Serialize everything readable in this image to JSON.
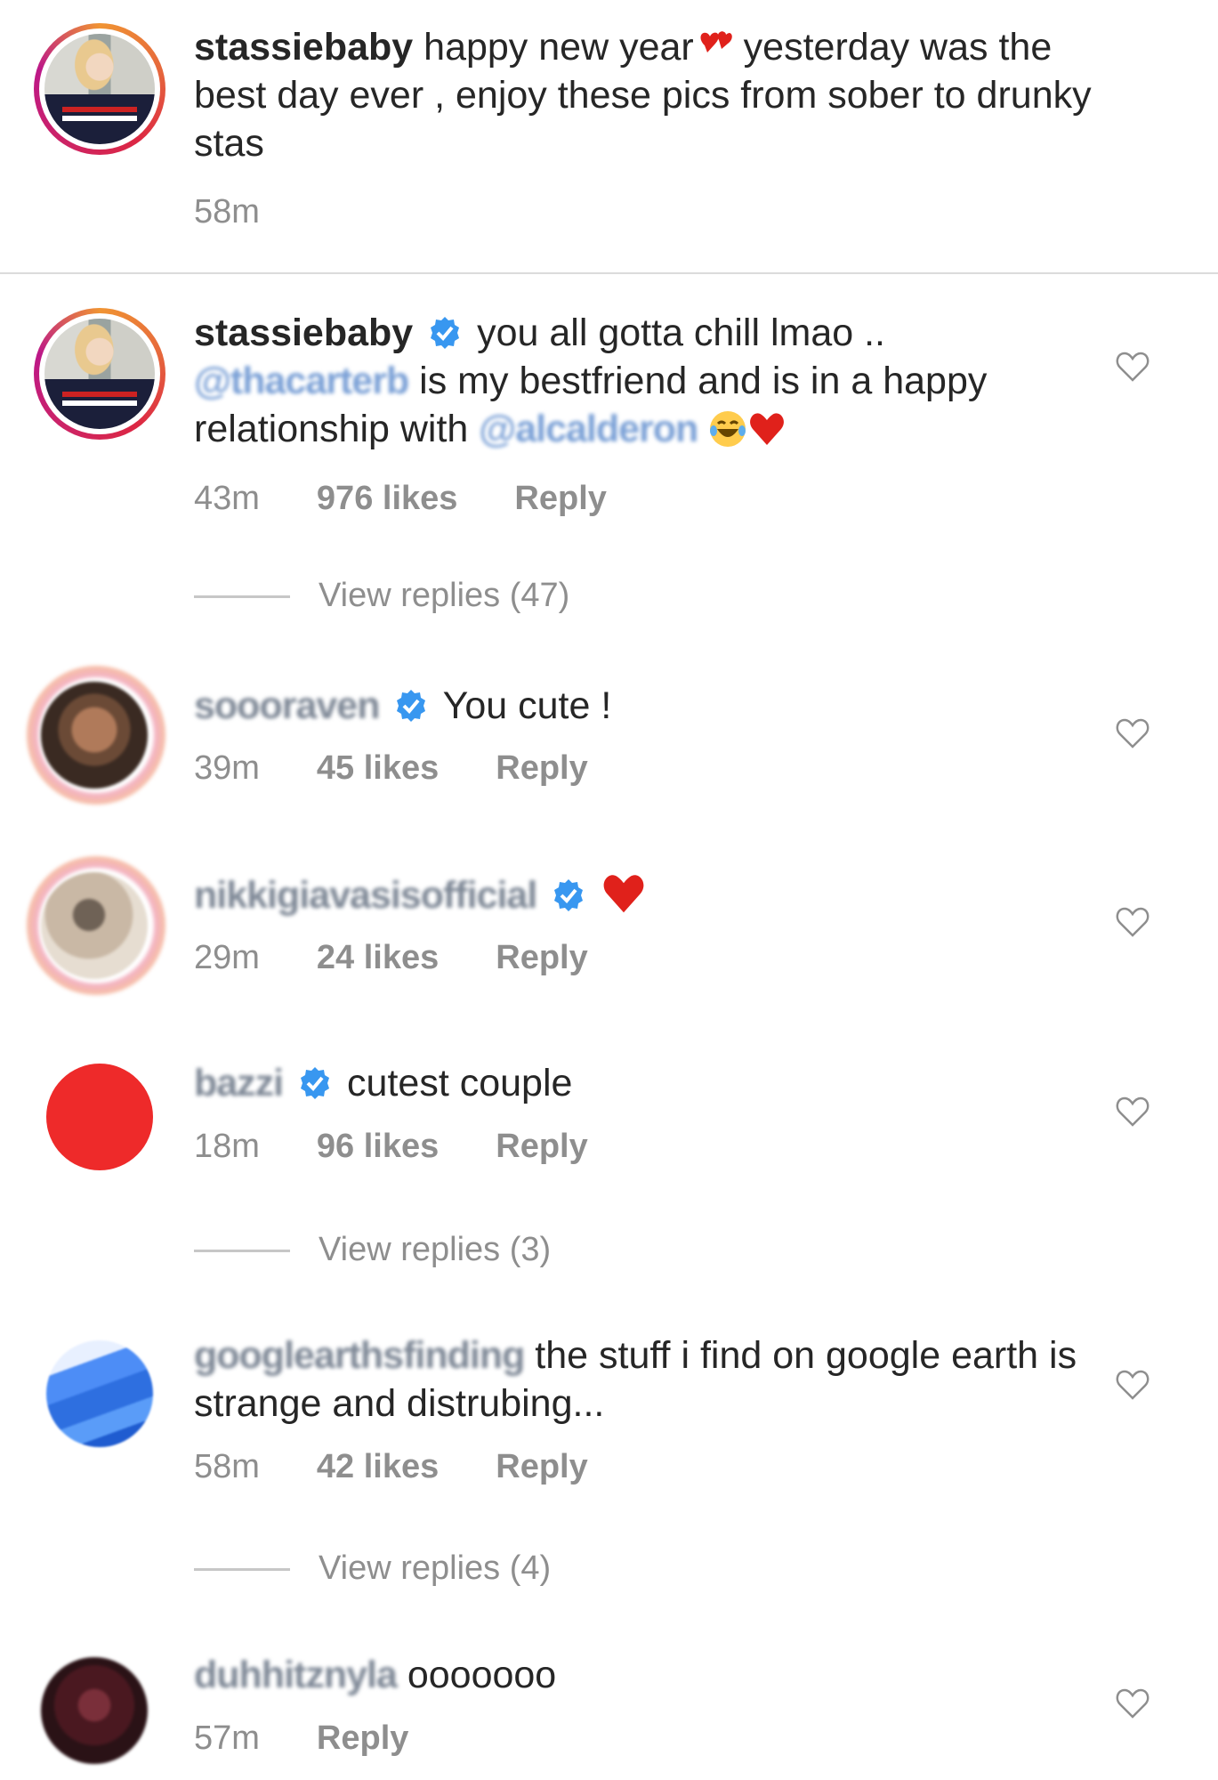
{
  "caption": {
    "username": "stassiebaby",
    "text_part1": " happy new year",
    "text_part2": " yesterday was the best day ever , enjoy these pics from sober to drunky stas",
    "time": "58m"
  },
  "comments": [
    {
      "username": "stassiebaby",
      "verified": true,
      "text_a": " you all gotta chill lmao ..",
      "mention1": "@thacarterb",
      "text_b": " is my bestfriend and is in a happy relationship with ",
      "mention2": "@alcalderon",
      "time": "43m",
      "likes": "976 likes",
      "reply": "Reply",
      "view_replies": "View replies (47)"
    },
    {
      "username": "soooraven",
      "verified": true,
      "text": " You cute !",
      "time": "39m",
      "likes": "45 likes",
      "reply": "Reply"
    },
    {
      "username": "nikkigiavasisofficial",
      "verified": true,
      "text": "",
      "time": "29m",
      "likes": "24 likes",
      "reply": "Reply"
    },
    {
      "username": "bazzi",
      "verified": true,
      "text": " cutest couple",
      "time": "18m",
      "likes": "96 likes",
      "reply": "Reply",
      "view_replies": "View replies (3)"
    },
    {
      "username": "googlearthsfinding",
      "verified": false,
      "text": " the stuff i find on google earth is strange and distrubing...",
      "time": "58m",
      "likes": "42 likes",
      "reply": "Reply",
      "view_replies": "View replies (4)"
    },
    {
      "username": "duhhitznyla",
      "verified": false,
      "text": " ooooooo",
      "time": "57m",
      "reply": "Reply"
    }
  ],
  "icons": {
    "heart": "heart-outline-icon",
    "verified": "verified-badge-icon",
    "hearts_emoji": "two-hearts-emoji",
    "laugh_emoji": "tears-of-joy-emoji",
    "red_heart_emoji": "red-heart-emoji"
  },
  "colors": {
    "verified": "#3897f0",
    "meta": "#8e8e8e",
    "text": "#262626",
    "heart_emoji": "#e0211b"
  }
}
